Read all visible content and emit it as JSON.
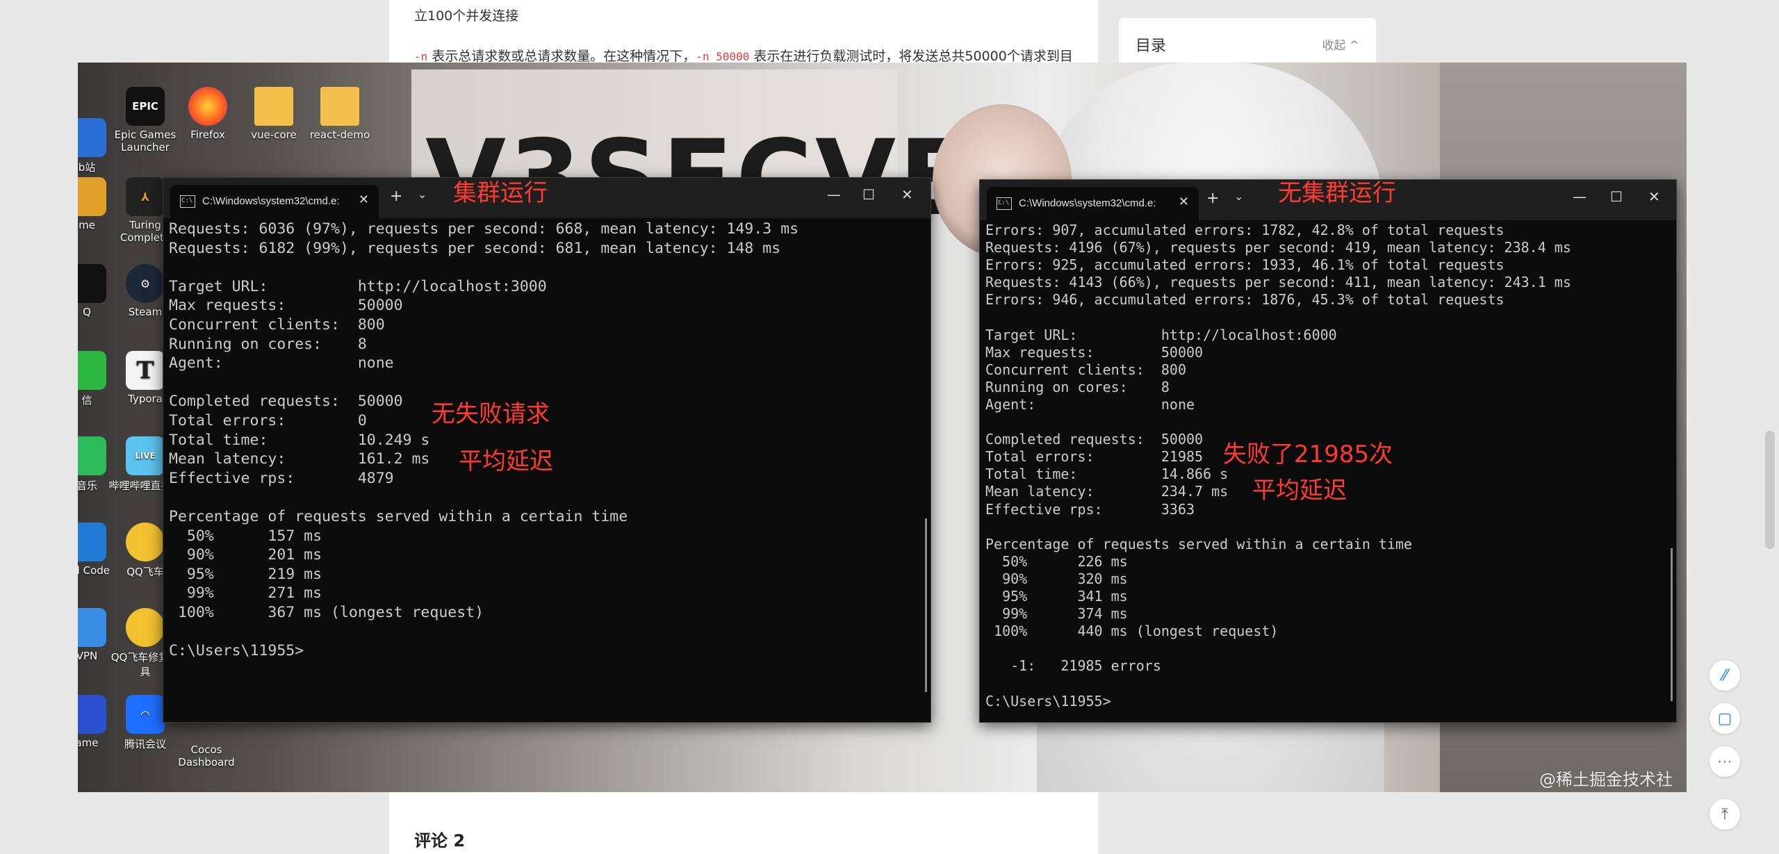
{
  "article": {
    "line1": "立100个并发连接",
    "line2_flag1": "-n",
    "line2_text1": " 表示总请求数或总请求数量。在这种情况下，",
    "line2_flag2": "-n 50000",
    "line2_text2": " 表示在进行负载测试时，将发送总共50000个请求到目",
    "comments_title": "评论 2"
  },
  "toc": {
    "title": "目录",
    "collapse": "收起 ^"
  },
  "desktop_icons": [
    {
      "label": "Epic Games Launcher",
      "icon": "EPIC"
    },
    {
      "label": "Firefox",
      "icon": "firefox-icon"
    },
    {
      "label": "vue-core",
      "icon": "folder-icon"
    },
    {
      "label": "react-demo",
      "icon": "folder-icon"
    },
    {
      "label": "Turing Complete",
      "icon": "turing-icon"
    },
    {
      "label": "Steam",
      "icon": "steam-icon"
    },
    {
      "label": "Typora",
      "icon": "T"
    },
    {
      "label": "哔哩哔哩直播姬",
      "icon": "LIVE"
    },
    {
      "label": "QQ飞车",
      "icon": "qq-speed-icon"
    },
    {
      "label": "QQ飞车修复工具",
      "icon": "qq-speed-icon"
    },
    {
      "label": "腾讯会议",
      "icon": "tencent-meeting-icon"
    },
    {
      "label": "Cocos Dashboard",
      "icon": "cocos-icon"
    }
  ],
  "desktop_edge_labels": [
    "b站",
    "me",
    "Q",
    "信",
    "音乐",
    "ual Code",
    "VPN",
    "ame"
  ],
  "terminal_left": {
    "tab_title": "C:\\Windows\\system32\\cmd.e:",
    "annotation_title": "集群运行",
    "lines": [
      "Requests: 6036 (97%), requests per second: 668, mean latency: 149.3 ms",
      "Requests: 6182 (99%), requests per second: 681, mean latency: 148 ms",
      "",
      "Target URL:          http://localhost:3000",
      "Max requests:        50000",
      "Concurrent clients:  800",
      "Running on cores:    8",
      "Agent:               none",
      "",
      "Completed requests:  50000",
      "Total errors:        0",
      "Total time:          10.249 s",
      "Mean latency:        161.2 ms",
      "Effective rps:       4879",
      "",
      "Percentage of requests served within a certain time",
      "  50%      157 ms",
      "  90%      201 ms",
      "  95%      219 ms",
      "  99%      271 ms",
      " 100%      367 ms (longest request)",
      "",
      "C:\\Users\\11955>"
    ],
    "note_errors": "无失败请求",
    "note_latency": "平均延迟"
  },
  "terminal_right": {
    "tab_title": "C:\\Windows\\system32\\cmd.e:",
    "annotation_title": "无集群运行",
    "lines": [
      "Errors: 907, accumulated errors: 1782, 42.8% of total requests",
      "Requests: 4196 (67%), requests per second: 419, mean latency: 238.4 ms",
      "Errors: 925, accumulated errors: 1933, 46.1% of total requests",
      "Requests: 4143 (66%), requests per second: 411, mean latency: 243.1 ms",
      "Errors: 946, accumulated errors: 1876, 45.3% of total requests",
      "",
      "Target URL:          http://localhost:6000",
      "Max requests:        50000",
      "Concurrent clients:  800",
      "Running on cores:    8",
      "Agent:               none",
      "",
      "Completed requests:  50000",
      "Total errors:        21985",
      "Total time:          14.866 s",
      "Mean latency:        234.7 ms",
      "Effective rps:       3363",
      "",
      "Percentage of requests served within a certain time",
      "  50%      226 ms",
      "  90%      320 ms",
      "  95%      341 ms",
      "  99%      374 ms",
      " 100%      440 ms (longest request)",
      "",
      "   -1:   21985 errors",
      "",
      "C:\\Users\\11955>"
    ],
    "note_errors": "失败了21985次",
    "note_latency": "平均延迟"
  },
  "watermark": "@稀土掘金技术社区",
  "window_controls": {
    "minimize": "—",
    "maximize": "☐",
    "close": "✕",
    "new_tab": "+",
    "dropdown": "⌄",
    "tab_close": "✕"
  }
}
